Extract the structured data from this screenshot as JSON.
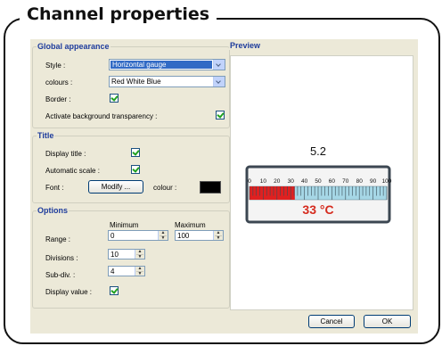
{
  "frame_title": "Channel properties",
  "global": {
    "legend": "Global appearance",
    "style_label": "Style :",
    "style_value": "Horizontal gauge",
    "colours_label": "colours :",
    "colours_value": "Red White Blue",
    "border_label": "Border :",
    "transparency_label": "Activate background transparency :"
  },
  "title": {
    "legend": "Title",
    "display_title_label": "Display title :",
    "auto_scale_label": "Automatic scale :",
    "font_label": "Font :",
    "modify_button": "Modify ...",
    "colour_label": "colour :"
  },
  "options": {
    "legend": "Options",
    "minimum_label": "Minimum",
    "maximum_label": "Maximum",
    "range_label": "Range :",
    "range_min": "0",
    "range_max": "100",
    "divisions_label": "Divisions :",
    "divisions_value": "10",
    "subdiv_label": "Sub-div. :",
    "subdiv_value": "4",
    "display_value_label": "Display value :"
  },
  "preview": {
    "legend": "Preview",
    "title_value": "5.2",
    "ticks": [
      "0",
      "10",
      "20",
      "30",
      "40",
      "50",
      "60",
      "70",
      "80",
      "90",
      "100"
    ],
    "reading": "33 °C",
    "fill_fraction": 0.33
  },
  "buttons": {
    "cancel": "Cancel",
    "ok": "OK"
  },
  "colors": {
    "gauge_fill": "#e02020",
    "gauge_empty": "#a6d7e6",
    "legend": "#1e3c9c",
    "reading": "#d52b1e"
  }
}
